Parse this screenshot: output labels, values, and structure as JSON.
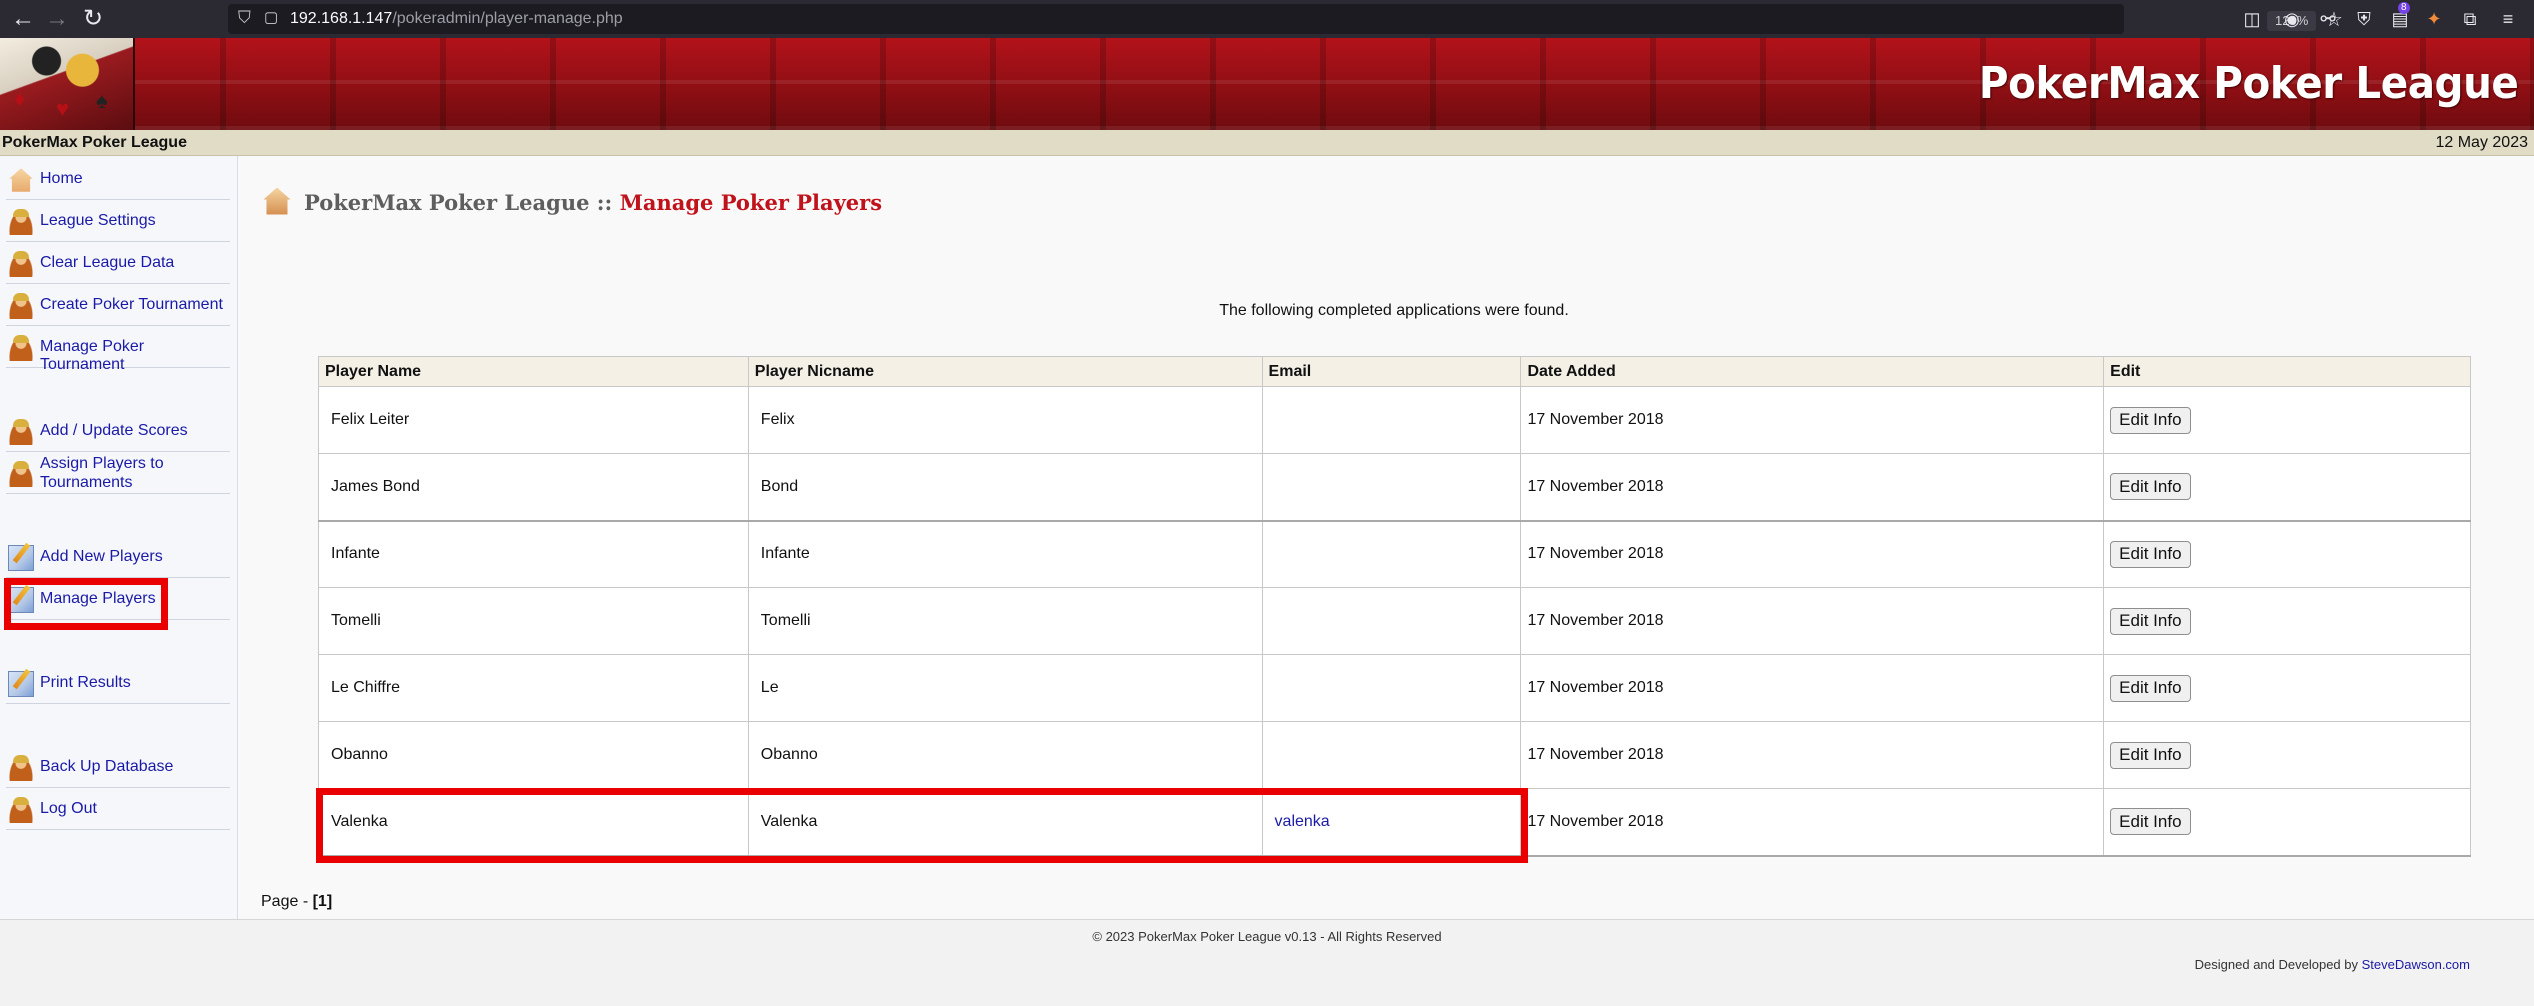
{
  "browser": {
    "url_host": "192.168.1.147",
    "url_path": "/pokeradmin/player-manage.php",
    "zoom": "120%",
    "extension_badge": "8"
  },
  "site": {
    "banner_title": "PokerMax Poker League",
    "name": "PokerMax Poker League",
    "date": "12 May 2023"
  },
  "sidebar": {
    "items": [
      {
        "label": "Home"
      },
      {
        "label": "League Settings"
      },
      {
        "label": "Clear League Data"
      },
      {
        "label": "Create Poker Tournament"
      },
      {
        "label": "Manage Poker Tournament"
      },
      {
        "label": "Add / Update Scores"
      },
      {
        "label": "Assign Players to Tournaments"
      },
      {
        "label": "Add New Players"
      },
      {
        "label": "Manage Players"
      },
      {
        "label": "Print Results"
      },
      {
        "label": "Back Up Database"
      },
      {
        "label": "Log Out"
      }
    ]
  },
  "main": {
    "heading_league": "PokerMax Poker League",
    "heading_sep": " :: ",
    "heading_page": "Manage Poker Players",
    "message": "The following completed applications were found.",
    "columns": [
      "Player Name",
      "Player Nicname",
      "Email",
      "Date Added",
      "Edit"
    ],
    "rows": [
      {
        "name": "Felix Leiter",
        "nick": "Felix",
        "email": "",
        "date": "17 November 2018",
        "edit": "Edit Info"
      },
      {
        "name": "James Bond",
        "nick": "Bond",
        "email": "",
        "date": "17 November 2018",
        "edit": "Edit Info"
      },
      {
        "name": "Infante",
        "nick": "Infante",
        "email": "",
        "date": "17 November 2018",
        "edit": "Edit Info"
      },
      {
        "name": "Tomelli",
        "nick": "Tomelli",
        "email": "",
        "date": "17 November 2018",
        "edit": "Edit Info"
      },
      {
        "name": "Le Chiffre",
        "nick": "Le",
        "email": "",
        "date": "17 November 2018",
        "edit": "Edit Info"
      },
      {
        "name": "Obanno",
        "nick": "Obanno",
        "email": "",
        "date": "17 November 2018",
        "edit": "Edit Info"
      },
      {
        "name": "Valenka",
        "nick": "Valenka",
        "email": "valenka",
        "date": "17 November 2018",
        "edit": "Edit Info"
      }
    ],
    "pager_label": "Page - ",
    "pager_current": "[1]"
  },
  "footer": {
    "copyright": "© 2023 PokerMax Poker League v0.13 - All Rights Reserved",
    "credit_prefix": "Designed and Developed by ",
    "credit_link": "SteveDawson.com"
  }
}
